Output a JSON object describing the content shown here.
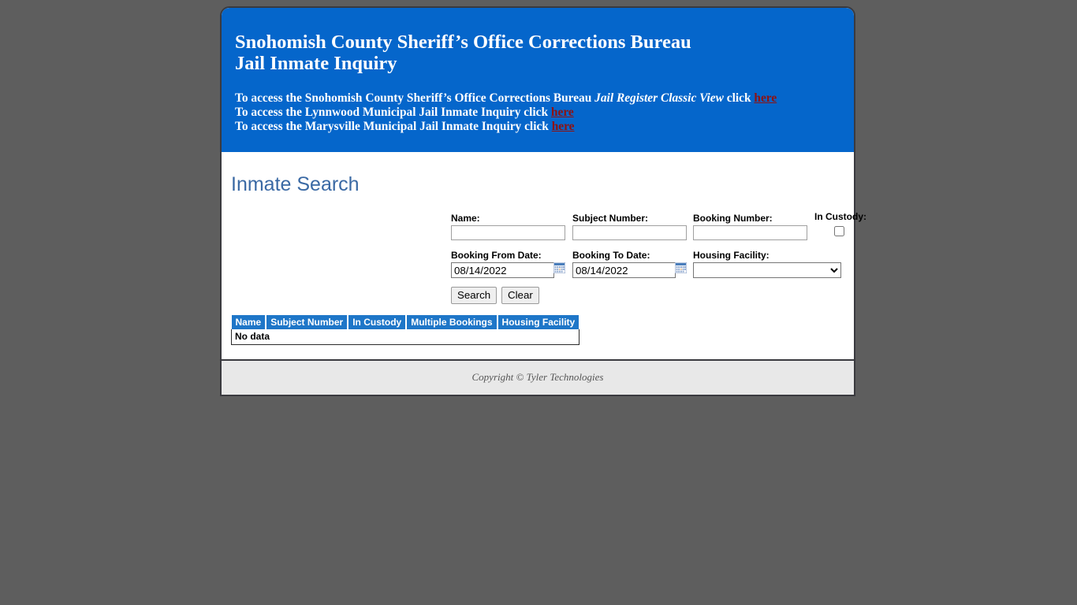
{
  "banner": {
    "title_line1": "Snohomish County Sheriff’s Office Corrections Bureau",
    "title_line2": "Jail Inmate Inquiry",
    "link_lines": [
      {
        "prefix": "To access the Snohomish County Sheriff’s Office Corrections Bureau ",
        "italic": "Jail Register Classic View",
        "middle": " click ",
        "link": "here"
      },
      {
        "prefix": "To access the Lynnwood Municipal Jail Inmate Inquiry click ",
        "italic": "",
        "middle": "",
        "link": "here"
      },
      {
        "prefix": "To access the Marysville Municipal Jail Inmate Inquiry click ",
        "italic": "",
        "middle": "",
        "link": "here"
      }
    ],
    "background_color": "#0566CB",
    "link_color": "#8D1212"
  },
  "search": {
    "heading": "Inmate Search",
    "heading_color": "#3A69A4",
    "name_label": "Name:",
    "name_value": "",
    "subject_number_label": "Subject Number:",
    "subject_number_value": "",
    "booking_number_label": "Booking Number:",
    "booking_number_value": "",
    "in_custody_label": "In Custody:",
    "in_custody_checked": false,
    "booking_from_label": "Booking From Date:",
    "booking_from_value": "08/14/2022",
    "booking_to_label": "Booking To Date:",
    "booking_to_value": "08/14/2022",
    "housing_facility_label": "Housing Facility:",
    "housing_facility_value": "",
    "housing_facility_options": [
      ""
    ],
    "search_button": "Search",
    "clear_button": "Clear",
    "calendar_icon": "calendar-icon",
    "dropdown_icon": "chevron-down-icon"
  },
  "results": {
    "columns": [
      "Name",
      "Subject Number",
      "In Custody",
      "Multiple Bookings",
      "Housing Facility"
    ],
    "rows": [],
    "empty_message": "No data",
    "header_color": "#1E76C8"
  },
  "footer": {
    "copyright": "Copyright © Tyler Technologies"
  }
}
